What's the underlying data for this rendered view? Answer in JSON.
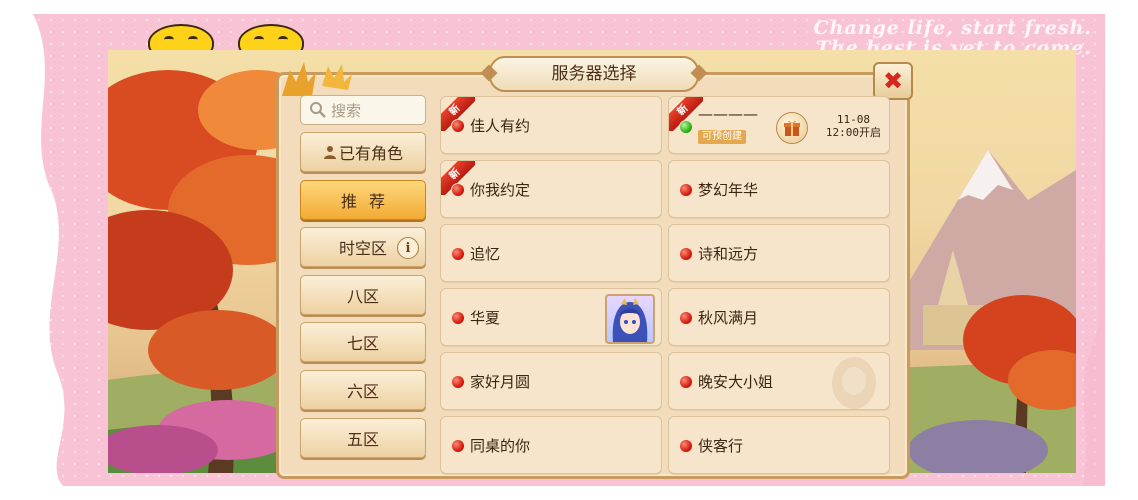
{
  "decor": {
    "tagline_line1": "Change life, start fresh.",
    "tagline_line2": "The best is yet to come."
  },
  "header": {
    "title": "服务器选择"
  },
  "close": {
    "symbol": "✖"
  },
  "search": {
    "placeholder": "搜索"
  },
  "sidebar": {
    "items": [
      {
        "label": "已有角色"
      },
      {
        "label": "推荐"
      },
      {
        "label": "时空区"
      },
      {
        "label": "八区"
      },
      {
        "label": "七区"
      },
      {
        "label": "六区"
      },
      {
        "label": "五区"
      }
    ],
    "info_symbol": "i"
  },
  "servers": [
    {
      "name": "佳人有约",
      "new_badge": "新"
    },
    {
      "name": "————",
      "new_badge": "新",
      "tag": "可预创建",
      "open_date": "11-08",
      "open_time": "12:00开启"
    },
    {
      "name": "你我约定",
      "new_badge": "新"
    },
    {
      "name": "梦幻年华"
    },
    {
      "name": "追忆"
    },
    {
      "name": "诗和远方"
    },
    {
      "name": "华夏"
    },
    {
      "name": "秋风满月"
    },
    {
      "name": "家好月圆"
    },
    {
      "name": "晚安大小姐"
    },
    {
      "name": "同桌的你"
    },
    {
      "name": "侠客行"
    }
  ],
  "colors": {
    "frame_pink": "#f9c3d6",
    "panel_bg": "#f2dcbb",
    "active_tab": "#f3ab35",
    "status_red": "#d21d12",
    "status_green": "#2fb316"
  }
}
